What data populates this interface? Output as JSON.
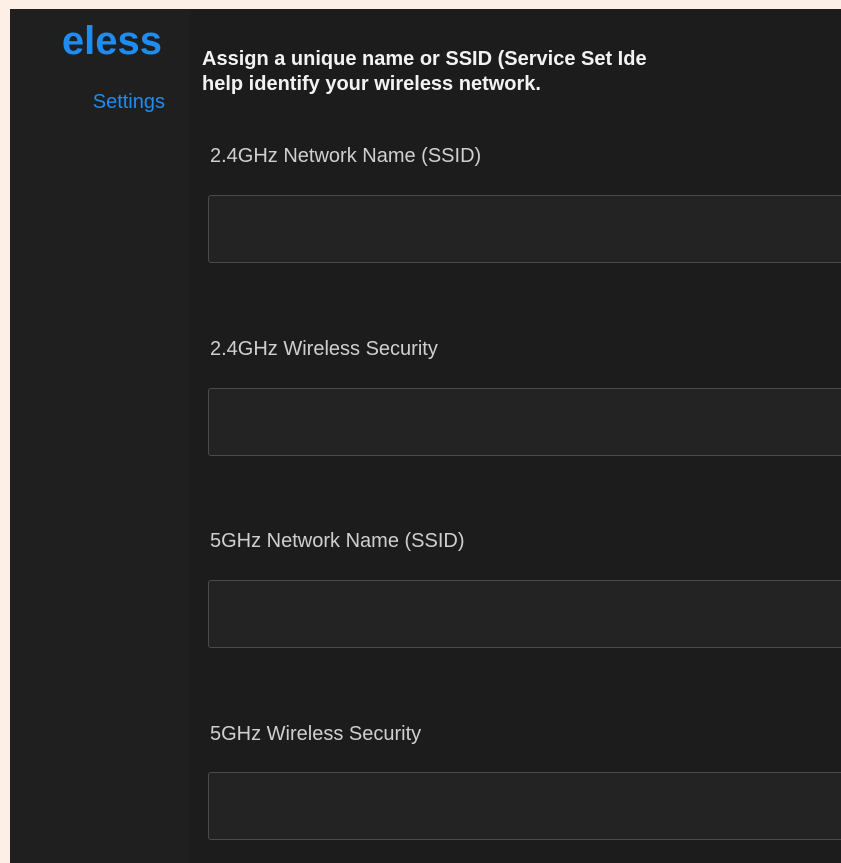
{
  "sidebar": {
    "title": "eless",
    "subtitle": "Settings"
  },
  "intro": {
    "line1": "Assign a unique name or SSID (Service Set Ide",
    "line2": "help identify your wireless network."
  },
  "fields": [
    {
      "label": "2.4GHz Network Name (SSID)",
      "value": ""
    },
    {
      "label": "2.4GHz Wireless Security",
      "value": ""
    },
    {
      "label": "5GHz Network Name (SSID)",
      "value": ""
    },
    {
      "label": "5GHz Wireless Security",
      "value": ""
    }
  ],
  "colors": {
    "accent": "#1f8cf0",
    "panel_bg": "#1c1c1d",
    "page_bg": "#fdeee6"
  }
}
